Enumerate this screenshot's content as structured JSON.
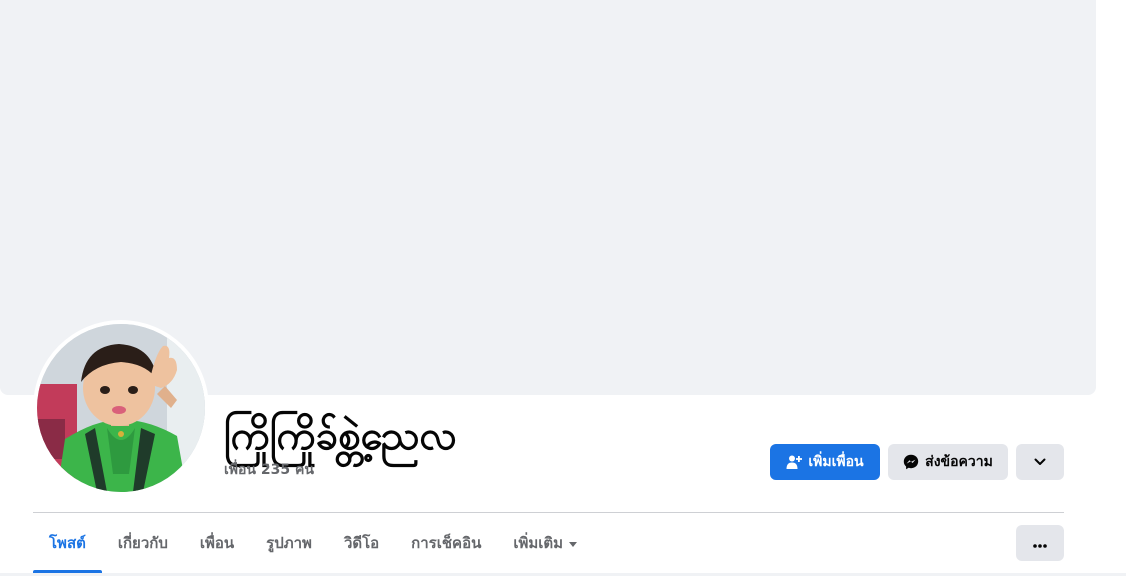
{
  "profile": {
    "name": "ကြိုကြိုခ်စ္တဲ့ညေလ",
    "friends_text": "เพื่อน 235 คน",
    "avatar_alt": "รูปโปรไฟล์"
  },
  "actions": {
    "add_friend_label": "เพิ่มเพื่อน",
    "message_label": "ส่งข้อความ",
    "add_friend_icon": "person-add-icon",
    "message_icon": "messenger-icon",
    "more_icon": "chevron-down-icon"
  },
  "tabs": [
    {
      "label": "โพสต์",
      "active": true
    },
    {
      "label": "เกี่ยวกับ",
      "active": false
    },
    {
      "label": "เพื่อน",
      "active": false
    },
    {
      "label": "รูปภาพ",
      "active": false
    },
    {
      "label": "วิดีโอ",
      "active": false
    },
    {
      "label": "การเช็คอิน",
      "active": false
    },
    {
      "label": "เพิ่มเติม",
      "active": false
    }
  ],
  "tabs_more_icon": "ellipsis-icon",
  "colors": {
    "accent": "#1b74e4",
    "cover_bg": "#f0f2f5",
    "secondary_button": "#e4e6eb",
    "muted_text": "#65676b"
  }
}
